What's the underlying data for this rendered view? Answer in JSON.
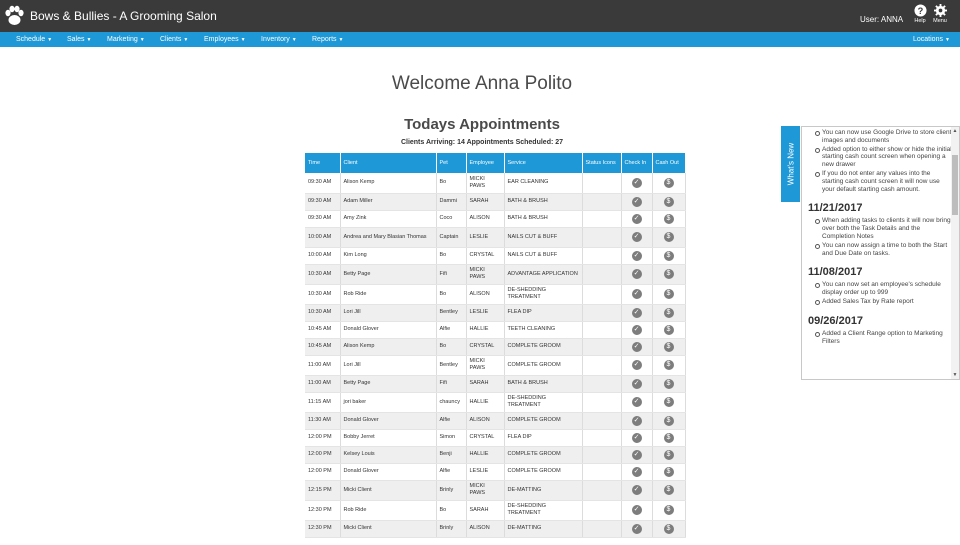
{
  "app": {
    "title": "Bows & Bullies - A Grooming Salon",
    "user": "User: ANNA"
  },
  "topbar": {
    "help_label": "Help",
    "menu_label": "Menu",
    "help_icon": "help-icon",
    "menu_icon": "gear-icon"
  },
  "nav": {
    "items": [
      {
        "label": "Schedule"
      },
      {
        "label": "Sales"
      },
      {
        "label": "Marketing"
      },
      {
        "label": "Clients"
      },
      {
        "label": "Employees"
      },
      {
        "label": "Inventory"
      },
      {
        "label": "Reports"
      }
    ],
    "right": "Locations"
  },
  "welcome": "Welcome Anna Polito",
  "appointments": {
    "title": "Todays Appointments",
    "arriving_label": "Clients Arriving:",
    "arriving_count": "14",
    "scheduled_label": "Appointments Scheduled:",
    "scheduled_count": "27",
    "headers": [
      "Time",
      "Client",
      "Pet",
      "Employee",
      "Service",
      "Status Icons",
      "Check In",
      "Cash Out"
    ],
    "rows": [
      [
        "09:30 AM",
        "Alison Kemp",
        "Bo",
        "MICKI PAWS",
        "EAR CLEANING"
      ],
      [
        "09:30 AM",
        "Adam Miller",
        "Dammi",
        "SARAH",
        "BATH & BRUSH"
      ],
      [
        "09:30 AM",
        "Amy Zink",
        "Coco",
        "ALISON",
        "BATH & BRUSH"
      ],
      [
        "10:00 AM",
        "Andrea and Mary Blasian Thomas",
        "Captain",
        "LESLIE",
        "NAILS CUT & BUFF"
      ],
      [
        "10:00 AM",
        "Kim Long",
        "Bo",
        "CRYSTAL",
        "NAILS CUT & BUFF"
      ],
      [
        "10:30 AM",
        "Betty Page",
        "Fifi",
        "MICKI PAWS",
        "ADVANTAGE APPLICATION"
      ],
      [
        "10:30 AM",
        "Rob Ride",
        "Bo",
        "ALISON",
        "DE-SHEDDING TREATMENT"
      ],
      [
        "10:30 AM",
        "Lori Jill",
        "Bentley",
        "LESLIE",
        "FLEA DIP"
      ],
      [
        "10:45 AM",
        "Donald Glover",
        "Alfie",
        "HALLIE",
        "TEETH CLEANING"
      ],
      [
        "10:45 AM",
        "Alison Kemp",
        "Bo",
        "CRYSTAL",
        "COMPLETE GROOM"
      ],
      [
        "11:00 AM",
        "Lori Jill",
        "Bentley",
        "MICKI PAWS",
        "COMPLETE GROOM"
      ],
      [
        "11:00 AM",
        "Betty Page",
        "Fifi",
        "SARAH",
        "BATH & BRUSH"
      ],
      [
        "11:15 AM",
        "jori baker",
        "chauncy",
        "HALLIE",
        "DE-SHEDDING TREATMENT"
      ],
      [
        "11:30 AM",
        "Donald Glover",
        "Alfie",
        "ALISON",
        "COMPLETE GROOM"
      ],
      [
        "12:00 PM",
        "Bobby Jerret",
        "Simon",
        "CRYSTAL",
        "FLEA DIP"
      ],
      [
        "12:00 PM",
        "Kelsey Louis",
        "Benji",
        "HALLIE",
        "COMPLETE GROOM"
      ],
      [
        "12:00 PM",
        "Donald Glover",
        "Alfie",
        "LESLIE",
        "COMPLETE GROOM"
      ],
      [
        "12:15 PM",
        "Micki Client",
        "Brinly",
        "MICKI PAWS",
        "DE-MATTING"
      ],
      [
        "12:30 PM",
        "Rob Ride",
        "Bo",
        "SARAH",
        "DE-SHEDDING TREATMENT"
      ],
      [
        "12:30 PM",
        "Micki Client",
        "Brinly",
        "ALISON",
        "DE-MATTING"
      ]
    ],
    "check_in_glyph": "✓",
    "cash_out_glyph": "$"
  },
  "whats_new": {
    "tab_label": "What's New",
    "intro_items": [
      "You can now use Google Drive to store client images and documents",
      "Added option to either show or hide the initial starting cash count screen when opening a new drawer",
      "If you do not enter any values into the starting cash count screen it will now use your default starting cash amount."
    ],
    "sections": [
      {
        "date": "11/21/2017",
        "items": [
          "When adding tasks to clients it will now bring over both the Task Details and the Completion Notes",
          "You can now assign a time to both the Start and Due Date on tasks."
        ]
      },
      {
        "date": "11/08/2017",
        "items": [
          "You can now set an employee's schedule display order up to 999",
          "Added Sales Tax by Rate report"
        ]
      },
      {
        "date": "09/26/2017",
        "items": [
          "Added a Client Range option to Marketing Filters"
        ]
      }
    ]
  },
  "colors": {
    "topbar": "#3a3a3a",
    "accent": "#1e98d6",
    "icon_grey": "#7d7d7d"
  }
}
